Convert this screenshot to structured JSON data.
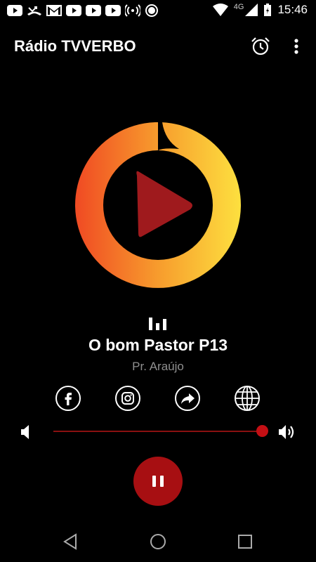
{
  "status_bar": {
    "time": "15:46",
    "network": "4G",
    "icons": [
      "youtube-icon",
      "missed-call-icon",
      "gmail-icon",
      "youtube-icon",
      "youtube-icon",
      "youtube-icon",
      "hotspot-icon",
      "record-icon"
    ]
  },
  "app_bar": {
    "title": "Rádio TVVERBO",
    "actions": [
      "alarm-icon",
      "more-vert-icon"
    ]
  },
  "player": {
    "title": "O bom Pastor P13",
    "artist": "Pr. Araújo",
    "volume": 1.0,
    "state_icon": "pause-icon"
  },
  "social": [
    "facebook-icon",
    "instagram-icon",
    "share-icon",
    "globe-icon"
  ],
  "colors": {
    "background": "#000000",
    "accent": "#a70f12",
    "logo_gradient_start": "#f04a23",
    "logo_gradient_end": "#fde03f",
    "logo_play": "#9f1a1d"
  },
  "nav": [
    "back-icon",
    "home-icon",
    "recents-icon"
  ]
}
